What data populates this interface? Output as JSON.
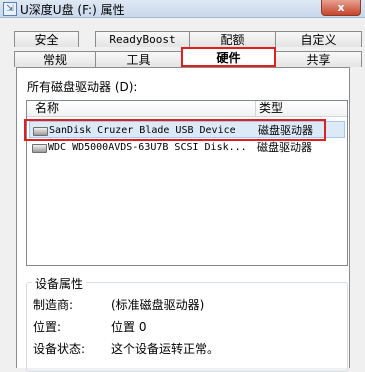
{
  "window": {
    "title": "U深度U盘 (F:) 属性",
    "close_label": "x"
  },
  "tabs": {
    "row1": [
      "安全",
      "ReadyBoost",
      "配额",
      "自定义"
    ],
    "row2": [
      "常规",
      "工具",
      "硬件",
      "共享"
    ],
    "active": "硬件"
  },
  "hardware": {
    "drives_label": "所有磁盘驱动器 (D):",
    "columns": {
      "name": "名称",
      "type": "类型"
    },
    "rows": [
      {
        "name": "SanDisk Cruzer Blade USB Device",
        "type": "磁盘驱动器",
        "selected": true
      },
      {
        "name": "WDC WD5000AVDS-63U7B SCSI Disk...",
        "type": "磁盘驱动器",
        "selected": false
      }
    ]
  },
  "properties": {
    "title": "设备属性",
    "items": [
      {
        "label": "制造商:",
        "value": "(标准磁盘驱动器)"
      },
      {
        "label": "位置:",
        "value": "位置 0"
      },
      {
        "label": "设备状态:",
        "value": "这个设备运转正常。"
      }
    ]
  },
  "colors": {
    "highlight": "#e02020",
    "selection": "#dce9f7"
  }
}
